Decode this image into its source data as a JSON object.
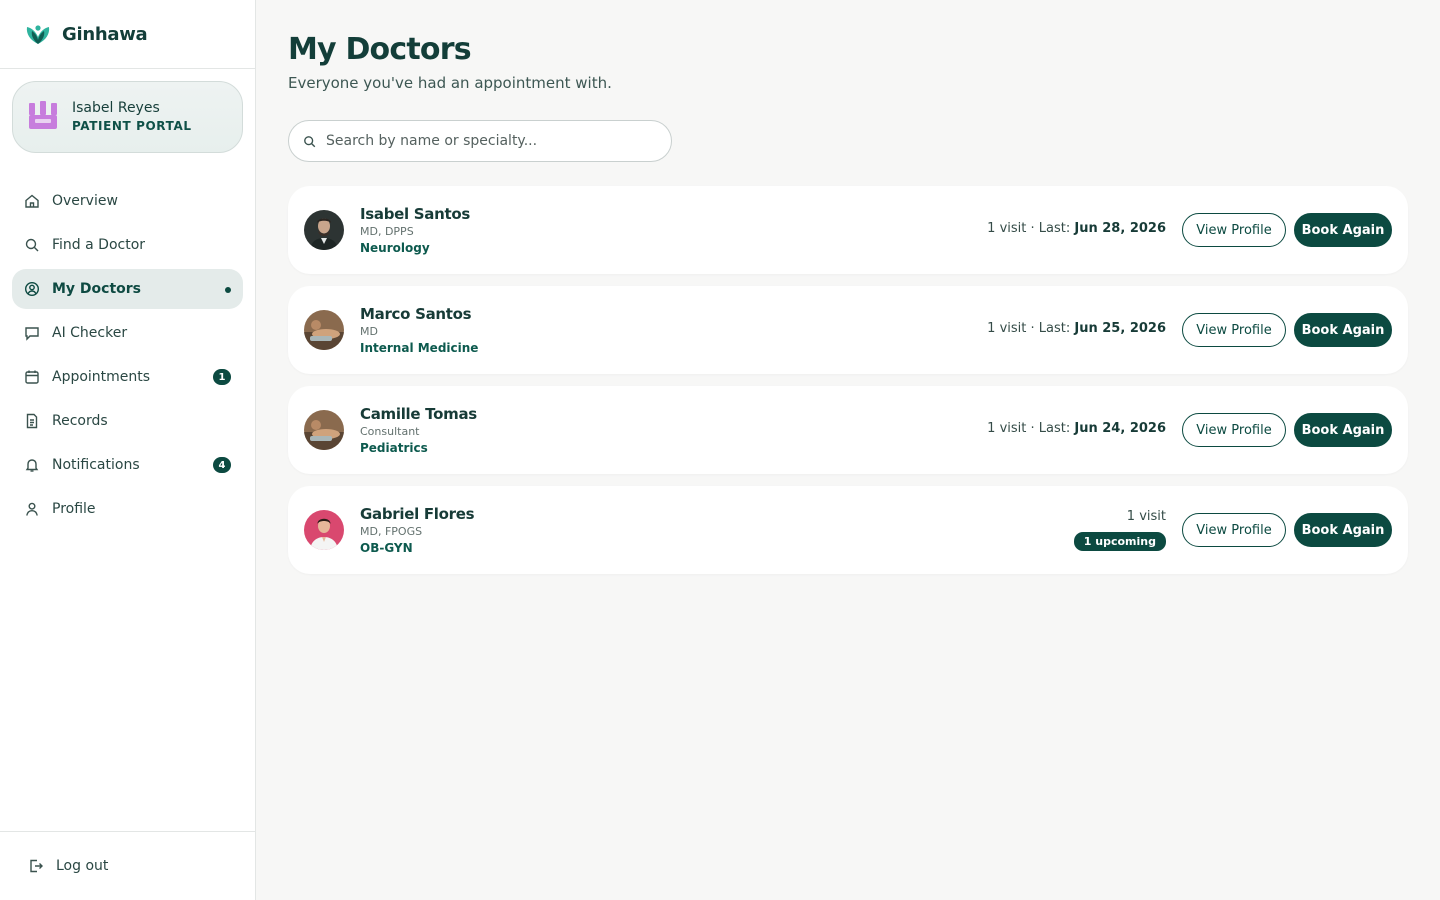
{
  "brand": {
    "name": "Ginhawa"
  },
  "user": {
    "name": "Isabel Reyes",
    "role": "PATIENT PORTAL"
  },
  "nav": {
    "items": [
      {
        "label": "Overview",
        "icon": "home-icon"
      },
      {
        "label": "Find a Doctor",
        "icon": "search-icon"
      },
      {
        "label": "My Doctors",
        "icon": "user-circle-icon",
        "active": true
      },
      {
        "label": "AI Checker",
        "icon": "chat-icon"
      },
      {
        "label": "Appointments",
        "icon": "calendar-icon",
        "badge": "1"
      },
      {
        "label": "Records",
        "icon": "document-icon"
      },
      {
        "label": "Notifications",
        "icon": "bell-icon",
        "badge": "4"
      },
      {
        "label": "Profile",
        "icon": "person-icon"
      }
    ]
  },
  "logout": {
    "label": "Log out"
  },
  "page": {
    "title": "My Doctors",
    "subtitle": "Everyone you've had an appointment with."
  },
  "search": {
    "placeholder": "Search by name or specialty..."
  },
  "doctors": [
    {
      "name": "Isabel Santos",
      "credentials": "MD, DPPS",
      "specialty": "Neurology",
      "visits": "1 visit",
      "last_label": "Last:",
      "last_date": "Jun 28, 2026"
    },
    {
      "name": "Marco Santos",
      "credentials": "MD",
      "specialty": "Internal Medicine",
      "visits": "1 visit",
      "last_label": "Last:",
      "last_date": "Jun 25, 2026"
    },
    {
      "name": "Camille Tomas",
      "credentials": "Consultant",
      "specialty": "Pediatrics",
      "visits": "1 visit",
      "last_label": "Last:",
      "last_date": "Jun 24, 2026"
    },
    {
      "name": "Gabriel Flores",
      "credentials": "MD, FPOGS",
      "specialty": "OB-GYN",
      "visits": "1 visit",
      "upcoming": "1 upcoming"
    }
  ],
  "actions": {
    "view_profile": "View Profile",
    "book_again": "Book Again"
  },
  "colors": {
    "primary": "#0c4a41",
    "accent": "#1f9e8a",
    "active_bg": "#e4ebea",
    "avatar_purple": "#c77ddd"
  }
}
